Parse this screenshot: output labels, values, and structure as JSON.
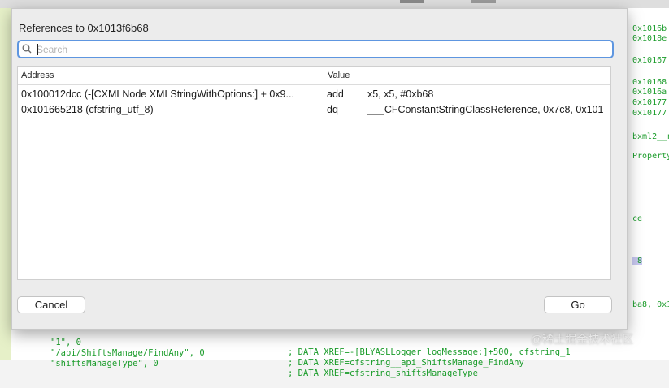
{
  "dialog": {
    "title": "References to 0x1013f6b68",
    "search_placeholder": "Search",
    "columns": {
      "address": "Address",
      "value": "Value"
    },
    "rows": [
      {
        "address": "0x100012dcc (-[CXMLNode XMLStringWithOptions:] + 0x9...",
        "mnemonic": "add",
        "operands": "x5, x5, #0xb68"
      },
      {
        "address": "0x101665218 (cfstring_utf_8)",
        "mnemonic": "dq",
        "operands": "___CFConstantStringClassReference, 0x7c8, 0x101"
      }
    ],
    "cancel_label": "Cancel",
    "go_label": "Go"
  },
  "background": {
    "right_lines": [
      "0x1016b",
      "0x1018e",
      "0x10167",
      "0x10168",
      "0x1016a",
      "0x10177",
      "0x10177",
      "bxml2__r",
      "Property",
      "ce",
      "_8",
      "ba8, 0x1"
    ],
    "bottom_lines": [
      {
        "left": "\"1\", 0",
        "right": "; DATA XREF=-[BLYASLLogger logMessage:]+500, cfstring_1"
      },
      {
        "left": "\"/api/ShiftsManage/FindAny\", 0",
        "right": "; DATA XREF=cfstring__api_ShiftsManage_FindAny"
      },
      {
        "left": "\"shiftsManageType\", 0",
        "right": "; DATA XREF=cfstring_shiftsManageType"
      }
    ]
  },
  "watermark": "@稀土掘金技术社区",
  "colors": {
    "code_green": "#1a9c2a",
    "focus_blue": "#5e96e0"
  }
}
